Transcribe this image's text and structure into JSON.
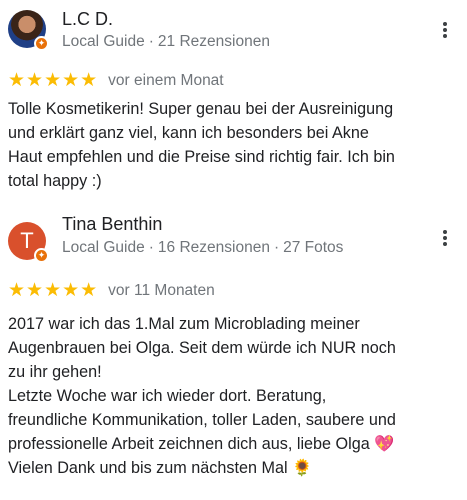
{
  "reviews": [
    {
      "author": "L.C D.",
      "avatar_icon": "profile-photo",
      "guide_label": "Local Guide",
      "review_count": "21 Rezensionen",
      "stars": "★★★★★",
      "rating": 5,
      "date": "vor einem Monat",
      "text": "Tolle Kosmetikerin! Super genau bei der Ausreinigung\nund erklärt ganz viel, kann ich besonders bei Akne\nHaut empfehlen und die Preise sind richtig fair. Ich bin\ntotal happy :)"
    },
    {
      "author": "Tina Benthin",
      "avatar_letter": "T",
      "guide_label": "Local Guide",
      "review_count": "16 Rezensionen",
      "photo_count": "27 Fotos",
      "stars": "★★★★★",
      "rating": 5,
      "date": "vor 11 Monaten",
      "text_lines": [
        "2017 war ich das 1.Mal zum Microblading meiner",
        "Augenbrauen bei Olga. Seit dem würde ich NUR noch",
        "zu ihr gehen!",
        "Letzte Woche war ich wieder dort. Beratung,",
        "freundliche Kommunikation, toller Laden, saubere und",
        "professionelle Arbeit zeichnen dich aus, liebe Olga"
      ],
      "text_heart": "💖",
      "text_last": "Vielen Dank und bis zum nächsten Mal",
      "text_sunflower": "🌻"
    }
  ],
  "colors": {
    "star": "#fbbc04",
    "badge": "#e8710a",
    "avatar_t": "#d9502c"
  }
}
